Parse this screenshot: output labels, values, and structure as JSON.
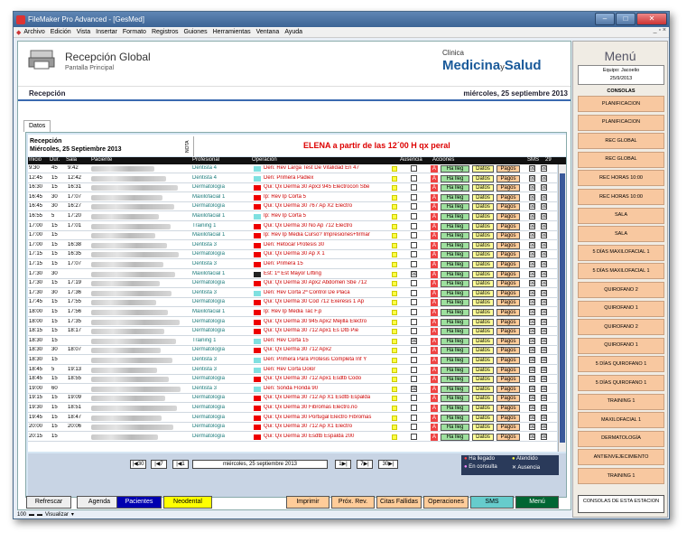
{
  "window": {
    "title": "FileMaker Pro Advanced - [GesMed]",
    "buttons": [
      "‒",
      "□",
      "✕"
    ]
  },
  "menubar": {
    "items": [
      "Archivo",
      "Edición",
      "Vista",
      "Insertar",
      "Formato",
      "Registros",
      "Guiones",
      "Herramientas",
      "Ventana",
      "Ayuda"
    ],
    "doc_controls": "_ ▫ ×"
  },
  "header": {
    "title": "Recepción Global",
    "subtitle": "Pantalla Principal",
    "brand_small": "Clinica",
    "brand_1": "Medicina",
    "brand_sep": "y",
    "brand_2": "Salud"
  },
  "recbar": {
    "left": "Recepción",
    "right": "miércoles, 25 septiembre 2013"
  },
  "tab": "Datos",
  "panel": {
    "recepcion": "Recepción",
    "date": "Miércoles, 25 Septiembre 2013",
    "nota": "NOTA",
    "message": "ELENA a partir de las 12´00 H  qx peral"
  },
  "table_headers": {
    "inicio": "Inicio",
    "dur": "Dur.",
    "sala": "Sala",
    "paciente": "Paciente",
    "profesional": "Profesional",
    "operacion": "Operación",
    "ausencia": "Ausencia",
    "acciones": "Acciones",
    "sms": "SMS",
    "n": "29"
  },
  "buttons": {
    "arrived": "Ha lleg",
    "datos": "Datos",
    "pagos": "Pagos"
  },
  "rows": [
    {
      "inicio": "9:30",
      "dur": "45",
      "sala": "9:42",
      "prof": "Dentista 4",
      "color": "#7fe0e0",
      "op": "Den: Rev Larga Test De Vitalidad En 47",
      "aus": "",
      "sms": [
        "☒",
        "☒"
      ]
    },
    {
      "inicio": "12:45",
      "dur": "15",
      "sala": "12:42",
      "prof": "Dentista 4",
      "color": "#7fe0e0",
      "op": "Den: Primera Padiex",
      "aus": "",
      "sms": [
        "☒",
        "☒"
      ]
    },
    {
      "inicio": "16:30",
      "dur": "15",
      "sala": "16:31",
      "prof": "Dermatología",
      "color": "#e00",
      "op": "Qui: Qx Derma 30 Apx3 945 Electrocon Sbe",
      "aus": "",
      "sms": [
        "☒",
        "☒"
      ]
    },
    {
      "inicio": "16:45",
      "dur": "30",
      "sala": "17:07",
      "prof": "Maxilofacial 1",
      "color": "#e00",
      "op": "Ip: Rev Ip Corta 5",
      "aus": "",
      "sms": [
        "☒",
        "☒"
      ]
    },
    {
      "inicio": "16:45",
      "dur": "30",
      "sala": "16:27",
      "prof": "Dermatología",
      "color": "#e00",
      "op": "Qui: Qx Derma 30 767 Ap X2 Electro",
      "aus": "",
      "sms": [
        "☒",
        "☒"
      ]
    },
    {
      "inicio": "16:55",
      "dur": "5",
      "sala": "17:20",
      "prof": "Maxilofacial 1",
      "color": "#7fe0e0",
      "op": "Ip: Rev Ip Corta 5",
      "aus": "",
      "sms": [
        "☒",
        "☒"
      ]
    },
    {
      "inicio": "17:00",
      "dur": "15",
      "sala": "17:01",
      "prof": "Training 1",
      "color": "#e00",
      "op": "Qui: Qx Derma 30 No Ap 712 Electro",
      "aus": "",
      "sms": [
        "☒",
        "☒"
      ]
    },
    {
      "inicio": "17:00",
      "dur": "15",
      "sala": "",
      "prof": "Maxilofacial 1",
      "color": "#e00",
      "op": "Ip: Rev Ip Media Curso? Impresiones+firmar",
      "aus": "",
      "sms": [
        "☒",
        "☒"
      ]
    },
    {
      "inicio": "17:00",
      "dur": "15",
      "sala": "16:38",
      "prof": "Dentista 3",
      "color": "#e00",
      "op": "Den: Retocar Protesis 30`",
      "aus": "",
      "sms": [
        "☒",
        "☒"
      ]
    },
    {
      "inicio": "17:15",
      "dur": "15",
      "sala": "16:35",
      "prof": "Dermatología",
      "color": "#e00",
      "op": "Qui: Qx Derma 30 Ap X 1",
      "aus": "",
      "sms": [
        "☒",
        "☒"
      ]
    },
    {
      "inicio": "17:15",
      "dur": "15",
      "sala": "17:07",
      "prof": "Dentista 3",
      "color": "#e00",
      "op": "Den: Primera 15`",
      "aus": "",
      "sms": [
        "☒",
        "☒"
      ]
    },
    {
      "inicio": "17:30",
      "dur": "30",
      "sala": "",
      "prof": "Maxilofacial 1",
      "color": "#222",
      "op": "Est: 1ª Est Mayor Lifting",
      "aus": "☒",
      "sms": [
        "☒",
        "☒"
      ]
    },
    {
      "inicio": "17:30",
      "dur": "15",
      "sala": "17:19",
      "prof": "Dermatología",
      "color": "#e00",
      "op": "Qui: Qx Derma 30 Apx2 Abdomen Sbe 712",
      "aus": "",
      "sms": [
        "☒",
        "☒"
      ]
    },
    {
      "inicio": "17:30",
      "dur": "30",
      "sala": "17:36",
      "prof": "Dentista 3",
      "color": "#7fe0e0",
      "op": "Den: Rev Corta 2ª Control De Placa",
      "aus": "",
      "sms": [
        "☒",
        "☒"
      ]
    },
    {
      "inicio": "17:45",
      "dur": "15",
      "sala": "17:55",
      "prof": "Dermatología",
      "color": "#e00",
      "op": "Qui: Qx Derma 30 Cod 712 Exeresis 1 Ap",
      "aus": "",
      "sms": [
        "☒",
        "☒"
      ]
    },
    {
      "inicio": "18:00",
      "dur": "15",
      "sala": "17:56",
      "prof": "Maxilofacial 1",
      "color": "#e00",
      "op": "Ip: Rev Ip Media Tac F.p",
      "aus": "",
      "sms": [
        "☒",
        "☒"
      ]
    },
    {
      "inicio": "18:00",
      "dur": "15",
      "sala": "17:35",
      "prof": "Dermatología",
      "color": "#e00",
      "op": "Qui: Qx Derma 30 945 Apx2 Mejilla Electro",
      "aus": "",
      "sms": [
        "☒",
        "☒"
      ]
    },
    {
      "inicio": "18:15",
      "dur": "15",
      "sala": "18:17",
      "prof": "Dermatología",
      "color": "#e00",
      "op": "Qui: Qx Derma 30 712 Apx1 Es Dtb Pie",
      "aus": "",
      "sms": [
        "☒",
        "☒"
      ]
    },
    {
      "inicio": "18:30",
      "dur": "15",
      "sala": "",
      "prof": "Training 1",
      "color": "#7fe0e0",
      "op": "Den: Rev Corta 15",
      "aus": "☒",
      "sms": [
        "☒",
        "☒"
      ]
    },
    {
      "inicio": "18:30",
      "dur": "30",
      "sala": "18:07",
      "prof": "Dermatología",
      "color": "#e00",
      "op": "Qui: Qx Derma 30 712 Apx2",
      "aus": "",
      "sms": [
        "☒",
        "☒"
      ]
    },
    {
      "inicio": "18:30",
      "dur": "15",
      "sala": "",
      "prof": "Dentista 3",
      "color": "#7fe0e0",
      "op": "Den: Primera Para Protesis Completa Inf Y",
      "aus": "",
      "sms": [
        "☒",
        "☒"
      ]
    },
    {
      "inicio": "18:45",
      "dur": "5",
      "sala": "19:13",
      "prof": "Dentista 3",
      "color": "#7fe0e0",
      "op": "Den: Rev Corta Dolor",
      "aus": "",
      "sms": [
        "☒",
        "☒"
      ]
    },
    {
      "inicio": "18:45",
      "dur": "15",
      "sala": "18:55",
      "prof": "Dermatología",
      "color": "#e00",
      "op": "Qui: Qx Derma 30 712 Apx1 Esdtb Codo",
      "aus": "",
      "sms": [
        "☒",
        "☒"
      ]
    },
    {
      "inicio": "19:00",
      "dur": "60",
      "sala": "",
      "prof": "Dentista 3",
      "color": "#7fe0e0",
      "op": "Den: Sonda Florida 90",
      "aus": "☒",
      "sms": [
        "☒",
        "☒"
      ]
    },
    {
      "inicio": "19:15",
      "dur": "15",
      "sala": "19:09",
      "prof": "Dermatología",
      "color": "#e00",
      "op": "Qui: Qx Derma 30 712 Ap X1 Esdtb Espalda",
      "aus": "",
      "sms": [
        "☒",
        "☒"
      ]
    },
    {
      "inicio": "19:30",
      "dur": "15",
      "sala": "18:51",
      "prof": "Dermatología",
      "color": "#e00",
      "op": "Qui: Qx Derma 30 Fibromas Electro.no",
      "aus": "",
      "sms": [
        "☒",
        "☒"
      ]
    },
    {
      "inicio": "19:45",
      "dur": "15",
      "sala": "18:47",
      "prof": "Dermatología",
      "color": "#e00",
      "op": "Qui: Qx Derma 30 Portugal Electro Fibromas",
      "aus": "",
      "sms": [
        "☒",
        "☒"
      ]
    },
    {
      "inicio": "20:00",
      "dur": "15",
      "sala": "20:06",
      "prof": "Dermatología",
      "color": "#e00",
      "op": "Qui: Qx Derma 30 712 Ap X1 Electro",
      "aus": "",
      "sms": [
        "☒",
        "☒"
      ]
    },
    {
      "inicio": "20:15",
      "dur": "15",
      "sala": "",
      "prof": "Dermatología",
      "color": "#e00",
      "op": "Qui: Qx Derma 30 Esdtb Espalda 200",
      "aus": "",
      "sms": [
        "☒",
        "☒"
      ]
    }
  ],
  "footer": {
    "prev30": "|◀30",
    "prev7": "|◀7",
    "prev1": "|◀1",
    "date": "miércoles, 25 septiembre 2013",
    "next1": "1▶|",
    "next7": "7▶|",
    "next30": "30▶|"
  },
  "legend": {
    "a": "Ha llegado",
    "b": "En consulta",
    "c": "Atendido",
    "d": "Ausencia"
  },
  "bottom": {
    "refrescar": "Refrescar",
    "agenda": "Agenda",
    "pacientes": "Pacientes",
    "neodental": "Neodental",
    "imprimir": "Imprimir",
    "prox": "Próx. Rev.",
    "citas": "Citas Fallidas",
    "operaciones": "Operaciones",
    "sms": "SMS",
    "menu": "Menú"
  },
  "side": {
    "title": "Menú",
    "equipo": "Equipo: Jacoelio",
    "equipo_date": "25/9/2013",
    "consolas": "CONSOLAS",
    "buttons": [
      "PLANIFICACION",
      "PLANIFICACION",
      "REC GLOBAL",
      "REC GLOBAL",
      "REC HORAS 10:00",
      "REC HORAS 10:00",
      "SALA",
      "SALA",
      "5 DÍAS MAXILOFACIAL 1",
      "5 DÍAS MAXILOFACIAL 1",
      "QUIROFANO 2",
      "QUIROFANO 1",
      "QUIROFANO 2",
      "QUIROFANO 1",
      "5 DÍAS QUIROFANO 1",
      "5 DÍAS QUIROFANO 1",
      "TRAINING 1",
      "MAXILOFACIAL 1",
      "DERMATOLOGÍA",
      "ANTIENVEJECIMIENTO",
      "TRAINING 1"
    ],
    "bottom_btn": "CONSOLAS DE ESTA ESTACION"
  },
  "status": {
    "zoom": "100",
    "mode": "Visualizar"
  }
}
